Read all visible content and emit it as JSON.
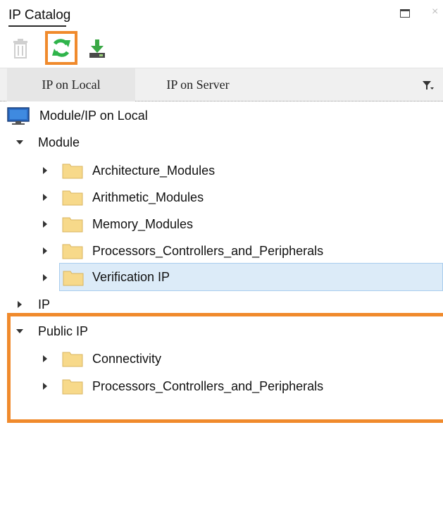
{
  "window": {
    "title": "IP Catalog",
    "maximize_icon": "maximize-icon",
    "close_glyph": "×"
  },
  "toolbar": {
    "delete_icon": "trash-icon",
    "refresh_icon": "refresh-icon",
    "download_icon": "download-icon"
  },
  "tabs": {
    "local": "IP on Local",
    "server": "IP on Server",
    "filter_icon": "filter-icon"
  },
  "tree": {
    "root": "Module/IP on Local",
    "module": {
      "label": "Module",
      "children": [
        "Architecture_Modules",
        "Arithmetic_Modules",
        "Memory_Modules",
        "Processors_Controllers_and_Peripherals",
        "Verification IP"
      ],
      "selected": "Verification IP"
    },
    "ip": {
      "label": "IP"
    },
    "public_ip": {
      "label": "Public IP",
      "children": [
        "Connectivity",
        "Processors_Controllers_and_Peripherals"
      ]
    }
  },
  "colors": {
    "highlight": "#f08a2c",
    "selection_bg": "#dcebf8",
    "folder": "#f7d98a",
    "refresh_green": "#2fb44b",
    "download_green": "#3aa845"
  }
}
